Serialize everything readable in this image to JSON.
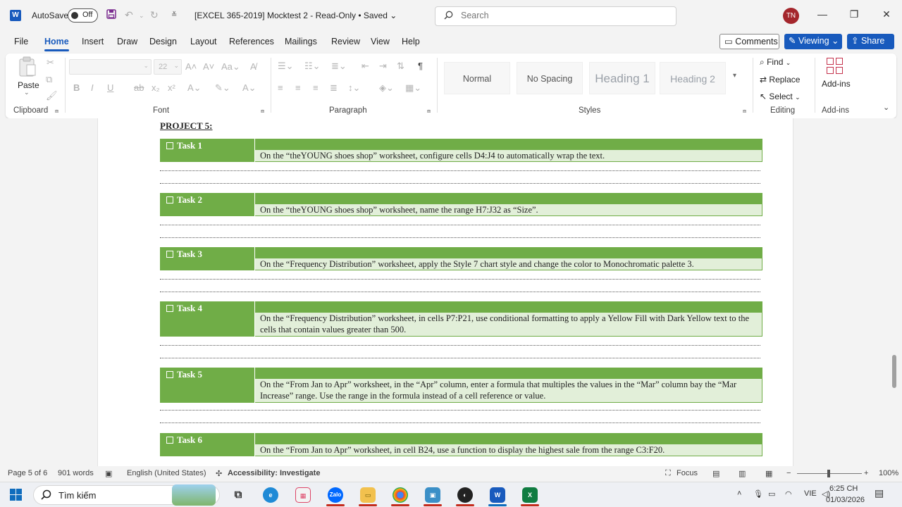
{
  "titlebar": {
    "autosave_label": "AutoSave",
    "autosave_state": "Off",
    "doc_title": "[EXCEL 365-2019] Mocktest 2  -  Read-Only • Saved",
    "search_placeholder": "Search",
    "user_initials": "TN"
  },
  "menu": {
    "tabs": [
      "File",
      "Home",
      "Insert",
      "Draw",
      "Design",
      "Layout",
      "References",
      "Mailings",
      "Review",
      "View",
      "Help"
    ],
    "active": "Home",
    "comments_label": "Comments",
    "viewing_label": "Viewing",
    "share_label": "Share"
  },
  "ribbon": {
    "clipboard": {
      "paste_label": "Paste",
      "group_label": "Clipboard"
    },
    "font": {
      "font_size": "22",
      "group_label": "Font"
    },
    "paragraph": {
      "group_label": "Paragraph"
    },
    "styles": {
      "group_label": "Styles",
      "items": [
        "Normal",
        "No Spacing",
        "Heading 1",
        "Heading 2"
      ]
    },
    "editing": {
      "find_label": "Find",
      "replace_label": "Replace",
      "select_label": "Select",
      "group_label": "Editing"
    },
    "addins": {
      "button_label": "Add-ins",
      "group_label": "Add-ins"
    }
  },
  "document": {
    "project_title": "PROJECT 5:",
    "tasks": [
      {
        "label": "Task 1",
        "text": "On the “theYOUNG shoes shop” worksheet, configure cells D4:J4 to automatically wrap the text."
      },
      {
        "label": "Task 2",
        "text": "On the “theYOUNG shoes shop” worksheet, name the range H7:J32 as “Size”."
      },
      {
        "label": "Task 3",
        "text": "On the “Frequency Distribution” worksheet, apply the Style 7 chart style and change the color to Monochromatic palette 3."
      },
      {
        "label": "Task 4",
        "text": "On the “Frequency Distribution” worksheet, in cells P7:P21, use conditional formatting to apply a Yellow Fill with Dark Yellow text to the cells that contain values greater than 500."
      },
      {
        "label": "Task 5",
        "text": "On the “From Jan to Apr” worksheet, in the “Apr” column, enter a formula that multiples the values in the “Mar” column bay the “Mar  Increase” range. Use the range in the formula instead of a cell reference or value."
      },
      {
        "label": "Task 6",
        "text": "On the “From Jan to Apr” worksheet, in cell B24, use a function to display the highest sale from the range C3:F20."
      }
    ]
  },
  "statusbar": {
    "page": "Page 5 of 6",
    "words": "901 words",
    "language": "English (United States)",
    "accessibility": "Accessibility: Investigate",
    "focus": "Focus",
    "zoom": "100%"
  },
  "taskbar": {
    "search_placeholder": "Tìm kiếm",
    "zalo_label": "Zalo",
    "lang": "VIE",
    "time": "6:25 CH",
    "date": "01/03/2026"
  },
  "colors": {
    "accent": "#185abd",
    "task_green": "#70ad47",
    "task_light_green": "#e2efd9"
  }
}
